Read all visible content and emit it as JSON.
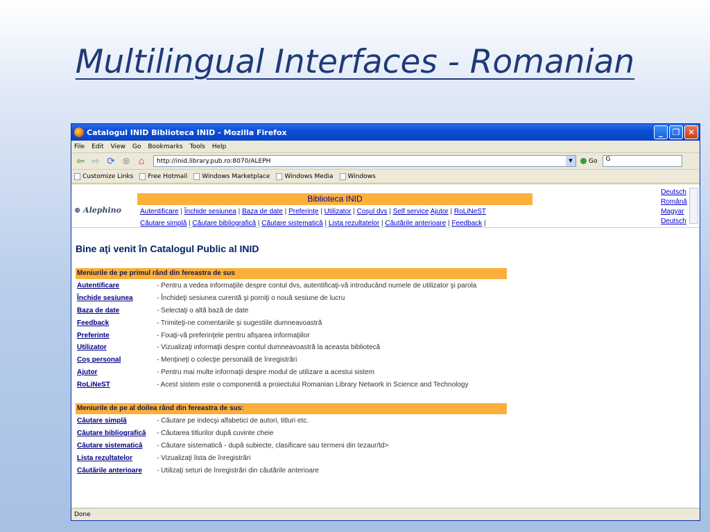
{
  "slide": {
    "title": "Multilingual Interfaces - Romanian"
  },
  "window": {
    "title": "Catalogul INID Biblioteca INID - Mozilla Firefox",
    "menu": [
      "File",
      "Edit",
      "View",
      "Go",
      "Bookmarks",
      "Tools",
      "Help"
    ],
    "url": "http://inid.library.pub.ro:8070/ALEPH",
    "go_label": "Go",
    "search_value": "G",
    "bookmarks": [
      "Customize Links",
      "Free Hotmail",
      "Windows Marketplace",
      "Windows Media",
      "Windows"
    ],
    "status": "Done"
  },
  "aleph": {
    "logo": "Alephino",
    "library_title": "Biblioteca INID",
    "nav_row1": [
      "Autentificare",
      "Închide sesiunea",
      "Baza de date",
      "Preferinţe",
      "Utilizator",
      "Coşul dvs",
      "Self service",
      "Ajutor",
      "RoLiNeST"
    ],
    "nav_row2": [
      "Căutare simplă",
      "Căutare bibliografică",
      "Căutare sistematică",
      "Lista rezultatelor",
      "Căutările anterioare",
      "Feedback"
    ],
    "languages": [
      "Deutsch",
      "Română",
      "Magyar",
      "Deutsch"
    ],
    "welcome": "Bine aţi venit în Catalogul Public al INID",
    "section1_title": "Meniurile de pe primul rând din fereastra de sus",
    "section1_items": [
      {
        "label": "Autentificare",
        "desc": "- Pentru a vedea informaţiile despre contul dvs, autentificaţi-vă introducând numele de utilizator şi parola"
      },
      {
        "label": "Închide sesiunea",
        "desc": "- Închideţi sesiunea curentă şi porniţi o nouă sesiune de lucru"
      },
      {
        "label": "Baza de date",
        "desc": "- Selectaţi o altă bază de date"
      },
      {
        "label": "Feedback",
        "desc": "- Trimiteţi-ne comentariile şi sugestiile dumneavoastră"
      },
      {
        "label": "Preferinte",
        "desc": "- Fixaţi-vă preferinţele pentru afişarea informaţiilor"
      },
      {
        "label": "Utilizator",
        "desc": "- Vizualizaţi informaţii despre contul dumneavoastră la aceasta bibliotecă"
      },
      {
        "label": "Coş personal",
        "desc": "- Menţineţi o colecţie personală de înregistrări"
      },
      {
        "label": "Ajutor",
        "desc": "- Pentru mai multe informaţii despre modul de utilizare a acestui sistem"
      },
      {
        "label": "RoLiNeST",
        "desc": "- Acest sistem este o componentă a proiectului Romanian Library Network in Science and Technology"
      }
    ],
    "section2_title": "Meniurile de pe al doilea rând din fereastra de sus:",
    "section2_items": [
      {
        "label": "Căutare simplă",
        "desc": "- Căutare pe indecşi alfabetici de autori, titluri etc."
      },
      {
        "label": "Căutare bibliografică",
        "desc": "- Căutarea titlurilor după cuvinte cheie"
      },
      {
        "label": "Căutare sistematică",
        "desc": "- Căutare sistematică - după subiecte, clasificare sau termeni din tezaur/td>"
      },
      {
        "label": "Lista rezultatelor",
        "desc": "- Vizualizaţi lista de înregistrări"
      },
      {
        "label": "Căutările anterioare",
        "desc": "- Utilizaţi seturi de înregistrări din căutările anterioare"
      }
    ]
  }
}
